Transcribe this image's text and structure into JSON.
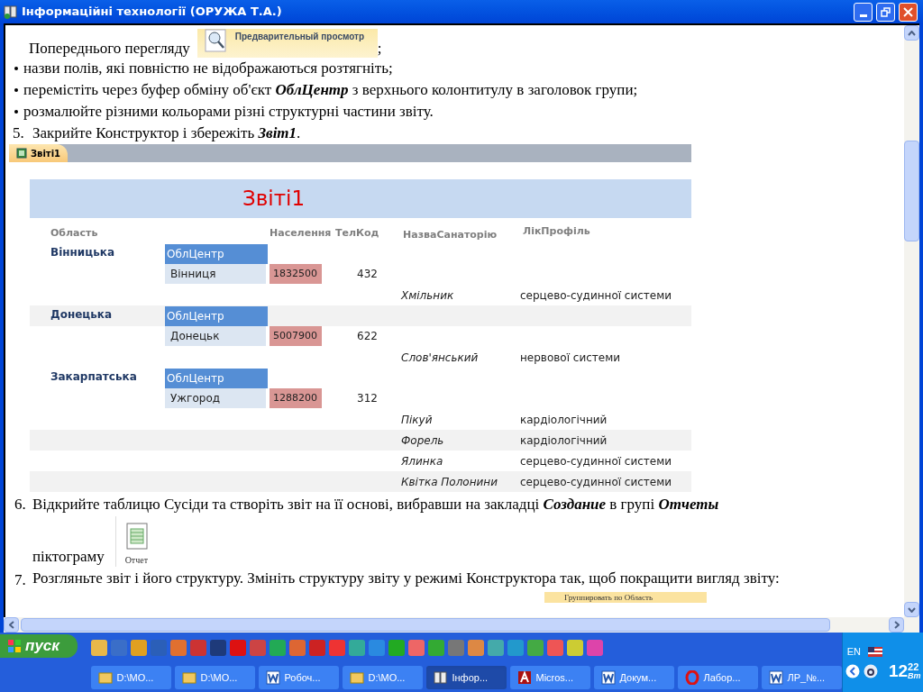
{
  "window": {
    "title": "Інформаційні технології (ОРУЖА Т.А.)"
  },
  "document": {
    "preview_line": {
      "text": "Попереднього перегляду",
      "button": "Предварительный просмотр",
      "after": ";"
    },
    "bullets": [
      "назви полів, які повністю не відображаються розтягніть;",
      "перемістіть через буфер обміну об'єкт **ОблЦентр** з верхнього колонтитулу в заголовок групи;",
      "розмалюйте різними кольорами різні структурні частини звіту."
    ],
    "step5": {
      "number": "5.",
      "text": "Закрийте Конструктор і збережіть **Звіт1**."
    },
    "report": {
      "tab": "Звіті1",
      "title": "Звіті1",
      "columns": [
        "Область",
        "Населення",
        "ТелКод",
        "НазваСанаторію",
        "ЛікПрофіль"
      ],
      "groups": [
        {
          "region": "Вінницька",
          "center_label": "ОблЦентр",
          "city": "Вінниця",
          "population": "1832500",
          "code": "432",
          "shaded": false,
          "sanatoria": [
            {
              "name": "Хмільник",
              "profile": "серцево-судинної системи",
              "shaded": false
            }
          ]
        },
        {
          "region": "Донецька",
          "center_label": "ОблЦентр",
          "city": "Донецьк",
          "population": "5007900",
          "code": "622",
          "shaded": true,
          "sanatoria": [
            {
              "name": "Слов'янський",
              "profile": "нервової системи",
              "shaded": false
            }
          ]
        },
        {
          "region": "Закарпатська",
          "center_label": "ОблЦентр",
          "city": "Ужгород",
          "population": "1288200",
          "code": "312",
          "shaded": false,
          "sanatoria": [
            {
              "name": "Пікуй",
              "profile": "кардіологічний",
              "shaded": false
            },
            {
              "name": "Форель",
              "profile": "кардіологічний",
              "shaded": true
            },
            {
              "name": "Ялинка",
              "profile": "серцево-судинної системи",
              "shaded": false
            },
            {
              "name": "Квітка Полонини",
              "profile": "серцево-судинної системи",
              "shaded": true
            }
          ]
        }
      ]
    },
    "step6": {
      "number": "6.",
      "text": "Відкрийте таблицю Сусіди та створіть звіт на її основі, вибравши на закладці **Создание** в групі **Отчеты**",
      "icon_line": "піктограму",
      "icon_label": "Отчет"
    },
    "step7": {
      "number": "7.",
      "text": "Розгляньте звіт і його структуру. Змініть структуру звіту у режимі Конструктора так, щоб покращити вигляд звіту:"
    },
    "cut_button": "Группировать по Область"
  },
  "taskbar": {
    "start": "пуск",
    "language": "EN",
    "clock": {
      "hours": "12",
      "minutes": "22",
      "day": "Вт"
    },
    "tasks": [
      {
        "label": "D:\\MO...",
        "kind": "folder",
        "selected": false
      },
      {
        "label": "D:\\MO...",
        "kind": "folder",
        "selected": false
      },
      {
        "label": "Робоч...",
        "kind": "word",
        "selected": false
      },
      {
        "label": "D:\\MO...",
        "kind": "folder",
        "selected": false
      },
      {
        "label": "Інфор...",
        "kind": "book",
        "selected": true
      },
      {
        "label": "Micros...",
        "kind": "access",
        "selected": false
      },
      {
        "label": "Докум...",
        "kind": "word",
        "selected": false
      },
      {
        "label": "Лабор...",
        "kind": "opera",
        "selected": false
      },
      {
        "label": "ЛР_№...",
        "kind": "word",
        "selected": false
      }
    ]
  }
}
